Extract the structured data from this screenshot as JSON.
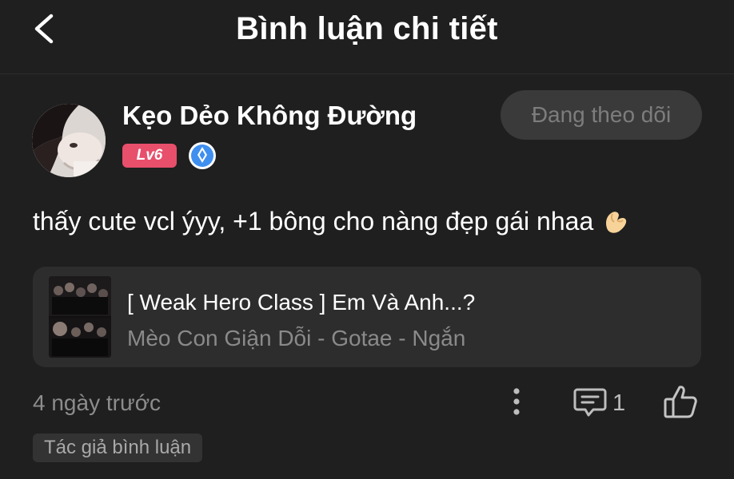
{
  "header": {
    "title": "Bình luận chi tiết",
    "back_icon": "chevron-left-icon"
  },
  "user": {
    "name": "Kẹo Dẻo Không Đường",
    "level": "Lv6",
    "follow_label": "Đang theo dõi",
    "verified_icon": "verified-badge-icon"
  },
  "comment": {
    "text": "thấy cute vcl ýyy, +1 bông cho nàng đẹp gái nhaa",
    "emoji": "pinching-hand-emoji"
  },
  "linked_story": {
    "title": "[ Weak Hero Class ] Em Và Anh...?",
    "subtitle": "Mèo Con Giận Dỗi - Gotae - Ngắn"
  },
  "footer": {
    "time": "4 ngày trước",
    "reply_count": "1",
    "author_tag": "Tác giả bình luận"
  },
  "colors": {
    "background": "#1f1f1f",
    "level_badge": "#e84f6b",
    "verified_badge": "#3f8ff0",
    "card": "#2d2d2d"
  }
}
